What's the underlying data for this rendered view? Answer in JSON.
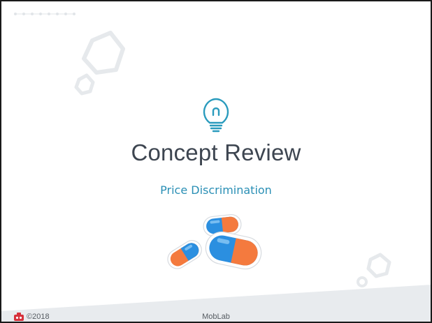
{
  "slide": {
    "title": "Concept Review",
    "subtitle": "Price Discrimination"
  },
  "footer": {
    "copyright": "©2018",
    "brand": "MobLab"
  },
  "icons": {
    "idea": "lightbulb-icon",
    "medicine": "pills-illustration",
    "logo": "moblab-logo-icon"
  },
  "colors": {
    "accent": "#2a8fb5",
    "title": "#3d4550",
    "pill_blue": "#2b8fe0",
    "pill_orange": "#f47a3e",
    "decoration": "#e6e9ec"
  }
}
